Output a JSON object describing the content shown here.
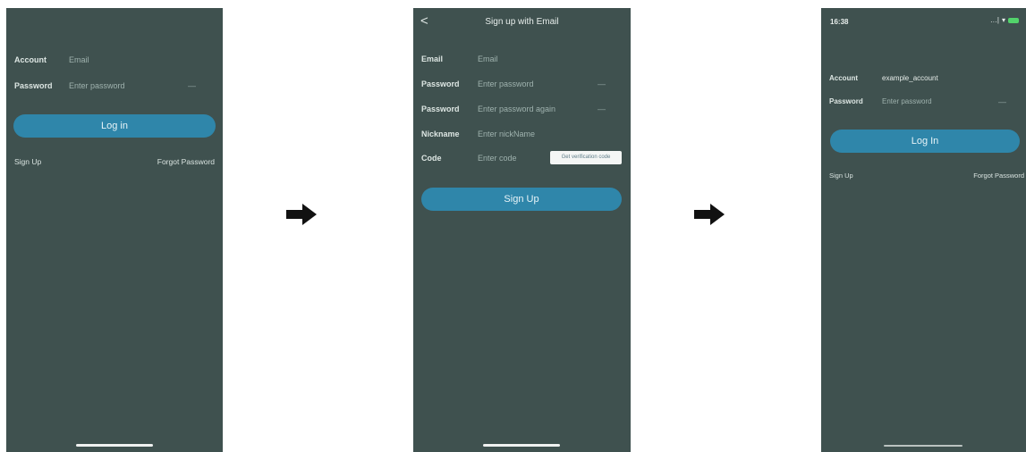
{
  "screen1": {
    "account_label": "Account",
    "account_placeholder": "Email",
    "password_label": "Password",
    "password_placeholder": "Enter password",
    "eye_icon_glyph": "—",
    "login_label": "Log in",
    "signup_link": "Sign Up",
    "forgot_link": "Forgot Password"
  },
  "screen2": {
    "back_glyph": "<",
    "title": "Sign up with Email",
    "email_label": "Email",
    "email_placeholder": "Email",
    "password_label": "Password",
    "password_placeholder": "Enter password",
    "password2_label": "Password",
    "password2_placeholder": "Enter password again",
    "nickname_label": "Nickname",
    "nickname_placeholder": "Enter nickName",
    "code_label": "Code",
    "code_placeholder": "Enter code",
    "get_code_button": "Get verification code",
    "signup_button": "Sign Up",
    "eye_icon_glyph": "—"
  },
  "screen3": {
    "status_time": "16:38",
    "signal_glyph": "…|",
    "wifi_glyph": "▾",
    "account_label": "Account",
    "account_value": "example_account",
    "password_label": "Password",
    "password_placeholder": "Enter password",
    "eye_icon_glyph": "—",
    "login_label": "Log In",
    "signup_link": "Sign Up",
    "forgot_link": "Forgot Password"
  },
  "colors": {
    "screen_bg": "#3f514f",
    "button": "#2f86aa",
    "battery": "#52d36b",
    "arrow": "#111111"
  }
}
